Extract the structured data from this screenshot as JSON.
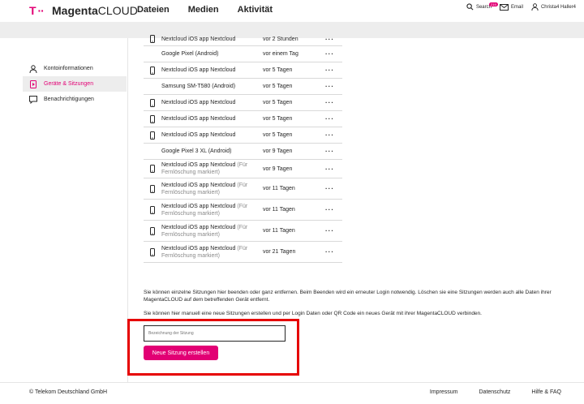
{
  "header": {
    "logo_mark": "T ··",
    "brand_bold": "Magenta",
    "brand_rest": "CLOUD",
    "nav": [
      "Dateien",
      "Medien",
      "Aktivität"
    ],
    "search_label": "Search",
    "email_label": "Email",
    "email_badge": "219",
    "user_name": "Christa4 Haller4"
  },
  "sidebar": {
    "items": [
      {
        "label": "Kontoinformationen",
        "active": false
      },
      {
        "label": "Geräte & Sitzungen",
        "active": true
      },
      {
        "label": "Benachrichtigungen",
        "active": false
      }
    ]
  },
  "devices": [
    {
      "name": "Nextcloud iOS app Nextcloud",
      "mark": "",
      "time": "vor 2 Stunden",
      "icon": "phone"
    },
    {
      "name": "Google Pixel (Android)",
      "mark": "",
      "time": "vor einem Tag",
      "icon": "none"
    },
    {
      "name": "Nextcloud iOS app Nextcloud",
      "mark": "",
      "time": "vor 5 Tagen",
      "icon": "phone"
    },
    {
      "name": "Samsung SM-T580 (Android)",
      "mark": "",
      "time": "vor 5 Tagen",
      "icon": "none"
    },
    {
      "name": "Nextcloud iOS app Nextcloud",
      "mark": "",
      "time": "vor 5 Tagen",
      "icon": "phone"
    },
    {
      "name": "Nextcloud iOS app Nextcloud",
      "mark": "",
      "time": "vor 5 Tagen",
      "icon": "phone"
    },
    {
      "name": "Nextcloud iOS app Nextcloud",
      "mark": "",
      "time": "vor 5 Tagen",
      "icon": "phone"
    },
    {
      "name": "Google Pixel 3 XL (Android)",
      "mark": "",
      "time": "vor 9 Tagen",
      "icon": "none"
    },
    {
      "name": "Nextcloud iOS app Nextcloud",
      "mark": "(Für Fernlöschung markiert)",
      "time": "vor 9 Tagen",
      "icon": "phone"
    },
    {
      "name": "Nextcloud iOS app Nextcloud",
      "mark": "(Für Fernlöschung markiert)",
      "time": "vor 11 Tagen",
      "icon": "phone"
    },
    {
      "name": "Nextcloud iOS app Nextcloud",
      "mark": "(Für Fernlöschung markiert)",
      "time": "vor 11 Tagen",
      "icon": "phone"
    },
    {
      "name": "Nextcloud iOS app Nextcloud",
      "mark": "(Für Fernlöschung markiert)",
      "time": "vor 11 Tagen",
      "icon": "phone"
    },
    {
      "name": "Nextcloud iOS app Nextcloud",
      "mark": "(Für Fernlöschung markiert)",
      "time": "vor 21 Tagen",
      "icon": "phone"
    }
  ],
  "more_label": "···",
  "info": {
    "text1": "Sie können einzelne Sitzungen hier beenden oder ganz entfernen. Beim Beenden wird ein erneuter Login notwendig. Löschen sie eine Sitzungen werden auch alle Daten ihrer MagentaCLOUD auf dem betreffenden Gerät entfernt.",
    "text2": "Sie können hier manuell eine neue Sitzungen erstellen und per Login Daten oder QR Code ein neues Gerät mit ihrer MagentaCLOUD verbinden."
  },
  "new_session": {
    "placeholder": "Bezeichnung der Sitzung",
    "button_label": "Neue Sitzung erstellen"
  },
  "footer": {
    "copyright": "© Telekom Deutschland GmbH",
    "links": [
      "Impressum",
      "Datenschutz",
      "Hilfe & FAQ"
    ]
  },
  "colors": {
    "accent": "#e20074",
    "highlight": "#e60000"
  }
}
